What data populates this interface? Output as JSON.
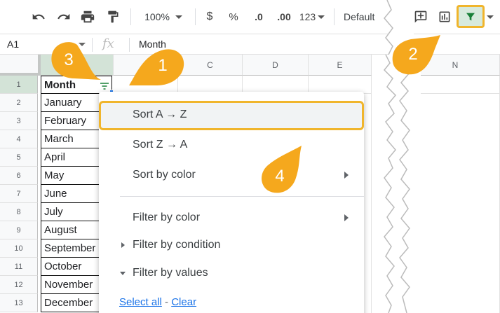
{
  "toolbar": {
    "zoom": "100%",
    "currency": "$",
    "percent": "%",
    "dec_decrease": ".0",
    "dec_increase": ".00",
    "number_format": "123",
    "font": "Default"
  },
  "formula_bar": {
    "cell_ref": "A1",
    "fx": "fx",
    "value": "Month"
  },
  "columns": [
    "C",
    "D",
    "E",
    "N"
  ],
  "rows": [
    "1",
    "2",
    "3",
    "4",
    "5",
    "6",
    "7",
    "8",
    "9",
    "10",
    "11",
    "12",
    "13"
  ],
  "column_a": [
    "Month",
    "January",
    "February",
    "March",
    "April",
    "May",
    "June",
    "July",
    "August",
    "September",
    "October",
    "November",
    "December"
  ],
  "menu": {
    "sort_az": "Sort A → Z",
    "sort_za": "Sort Z → A",
    "sort_by_color": "Sort by color",
    "filter_by_color": "Filter by color",
    "filter_by_condition": "Filter by condition",
    "filter_by_values": "Filter by values",
    "select_all": "Select all",
    "separator": "-",
    "clear": "Clear"
  },
  "callouts": [
    "1",
    "2",
    "3",
    "4"
  ],
  "colors": {
    "accent": "#f0b52c",
    "callout_fill": "#f5a81d",
    "filter_green": "#188038",
    "selected_header": "#d3e3d7"
  }
}
